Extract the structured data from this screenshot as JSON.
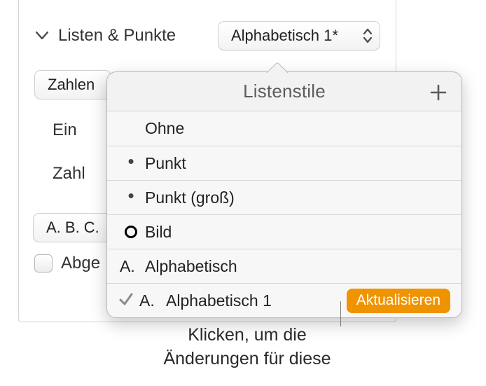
{
  "section": {
    "title": "Listen & Punkte",
    "style_select": "Alphabetisch 1*",
    "zahlen_label": "Zahlen",
    "ein_label": "Ein",
    "zahl_label": "Zahl",
    "abc_label": "A. B. C.",
    "abge_label": "Abge"
  },
  "popover": {
    "title": "Listenstile",
    "items": [
      {
        "marker": "",
        "label": "Ohne"
      },
      {
        "marker": "dot",
        "label": "Punkt"
      },
      {
        "marker": "dot",
        "label": "Punkt (groß)"
      },
      {
        "marker": "circle",
        "label": "Bild"
      },
      {
        "marker": "A.",
        "label": "Alphabetisch"
      },
      {
        "marker": "A.",
        "label": "Alphabetisch 1",
        "selected": true,
        "update": "Aktualisieren"
      }
    ]
  },
  "callout": {
    "line1": "Klicken, um die",
    "line2": "Änderungen für diese"
  }
}
